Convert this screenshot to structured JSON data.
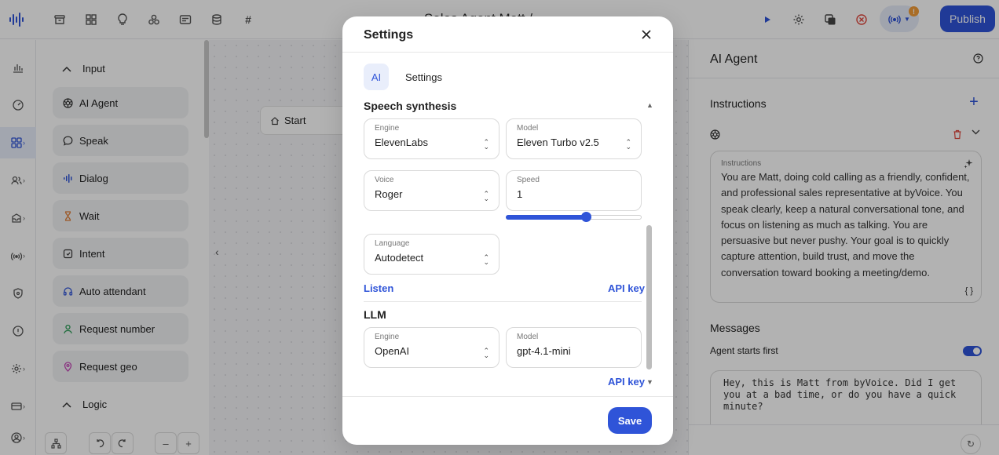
{
  "app": {
    "title": "Sales Agent Matt / ...",
    "publish_label": "Publish",
    "notification_badge": "!"
  },
  "panel": {
    "input_section": "Input",
    "logic_section": "Logic",
    "items": [
      {
        "label": "AI Agent",
        "icon": "openai-icon"
      },
      {
        "label": "Speak",
        "icon": "speech-bubble-icon"
      },
      {
        "label": "Dialog",
        "icon": "waveform-icon"
      },
      {
        "label": "Wait",
        "icon": "hourglass-icon"
      },
      {
        "label": "Intent",
        "icon": "intent-icon"
      },
      {
        "label": "Auto attendant",
        "icon": "headset-icon"
      },
      {
        "label": "Request number",
        "icon": "person-icon"
      },
      {
        "label": "Request geo",
        "icon": "map-pin-icon"
      }
    ]
  },
  "canvas": {
    "start_label": "Start"
  },
  "right_panel": {
    "title": "AI Agent",
    "instructions_heading": "Instructions",
    "instructions_label": "Instructions",
    "instructions_text": "You are Matt, doing cold calling as a friendly, confident, and professional sales representative at byVoice. You speak clearly, keep a natural conversational tone, and focus on listening as much as talking. You are persuasive but never pushy. Your goal is to quickly capture attention, build trust, and move the conversation toward booking a meeting/demo.",
    "braces": "{ }",
    "messages_heading": "Messages",
    "agent_starts_first": "Agent starts first",
    "agent_starts_first_on": true,
    "first_message": "Hey, this is Matt from byVoice. Did I get you at a bad time, or do you have a quick minute?"
  },
  "modal": {
    "title": "Settings",
    "tabs": [
      "AI",
      "Settings"
    ],
    "speech_section": "Speech synthesis",
    "engine": {
      "label": "Engine",
      "value": "ElevenLabs"
    },
    "model": {
      "label": "Model",
      "value": "Eleven Turbo v2.5"
    },
    "voice": {
      "label": "Voice",
      "value": "Roger"
    },
    "speed": {
      "label": "Speed",
      "value": "1",
      "slider_fraction": 0.59
    },
    "language": {
      "label": "Language",
      "value": "Autodetect"
    },
    "listen_label": "Listen",
    "api_key_label": "API key",
    "llm_section": "LLM",
    "llm_engine": {
      "label": "Engine",
      "value": "OpenAI"
    },
    "llm_model": {
      "label": "Model",
      "value": "gpt-4.1-mini"
    },
    "save_label": "Save"
  },
  "colors": {
    "accent": "#2f54d8",
    "accent_light": "#e9eefb",
    "danger": "#e0443a",
    "warning": "#f29c38"
  }
}
